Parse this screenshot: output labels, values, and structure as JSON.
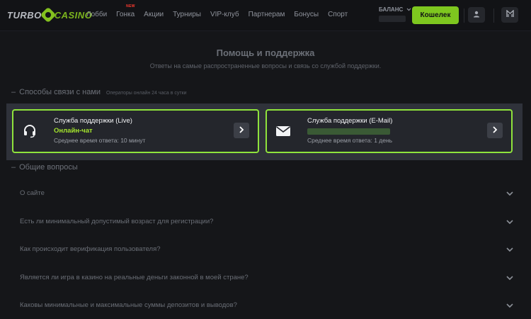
{
  "header": {
    "logo": {
      "part1": "TURBO",
      "part2": "CASINO"
    },
    "nav": [
      {
        "label": "Лобби"
      },
      {
        "label": "Гонка",
        "badge": "NEW"
      },
      {
        "label": "Акции"
      },
      {
        "label": "Турниры"
      },
      {
        "label": "VIP-клуб"
      },
      {
        "label": "Партнерам"
      },
      {
        "label": "Бонусы"
      },
      {
        "label": "Спорт"
      }
    ],
    "balance_label": "БАЛАНС",
    "wallet_button": "Кошелек",
    "icons": {
      "user": "user-icon",
      "extra": "grid-icon",
      "balance_toggle": "chevron-down-icon"
    }
  },
  "page": {
    "title": "Помощь и поддержка",
    "subtitle": "Ответы на самые распространенные вопросы и связь со службой поддержки."
  },
  "contacts_section": {
    "title": "Способы связи с нами",
    "note": "Операторы онлайн 24 часа в сутки",
    "cards": [
      {
        "title": "Служба поддержки (Live)",
        "subtitle": "Онлайн-чат",
        "time": "Среднее время ответа: 10 минут",
        "icon": "headset-icon"
      },
      {
        "title": "Служба поддержки (E-Mail)",
        "subtitle": "",
        "time": "Среднее время ответа: 1 день",
        "icon": "envelope-icon"
      }
    ]
  },
  "faq_section": {
    "title": "Общие вопросы",
    "items": [
      {
        "question": "О сайте"
      },
      {
        "question": "Есть ли минимальный допустимый возраст для регистрации?"
      },
      {
        "question": "Как происходит верификация пользователя?"
      },
      {
        "question": "Является ли игра в казино на реальные деньги законной в моей стране?"
      },
      {
        "question": "Каковы минимальные и максимальные суммы депозитов и выводов?"
      }
    ]
  },
  "colors": {
    "accent": "#7ec71f",
    "card_border": "#8fe33c",
    "live_text": "#a5e62d",
    "background": "#151619",
    "new_badge": "#ff3b30"
  }
}
